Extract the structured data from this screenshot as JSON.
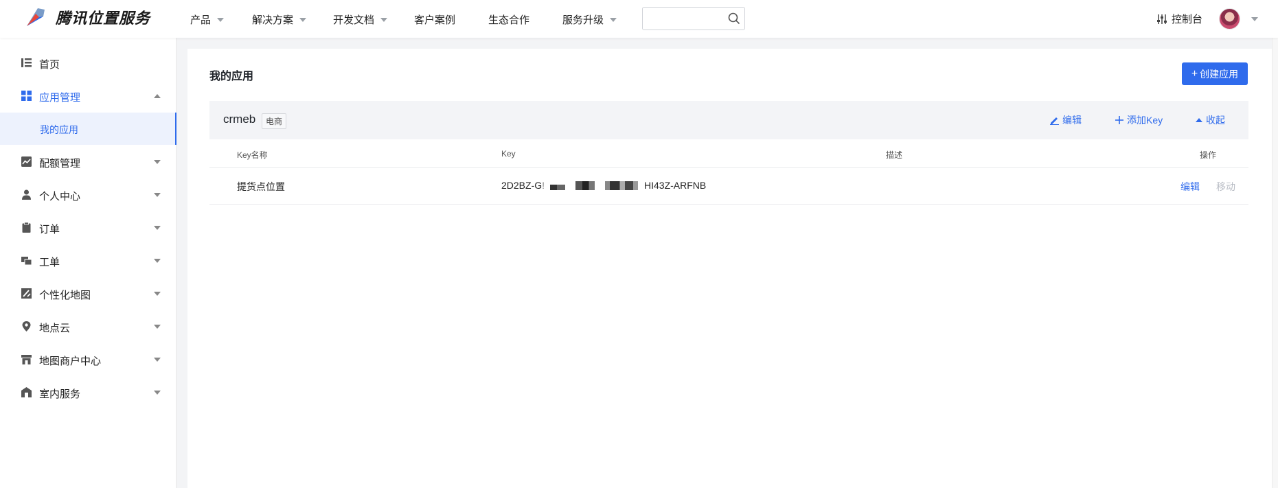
{
  "brand": {
    "name": "腾讯位置服务"
  },
  "nav": {
    "items": [
      {
        "label": "产品",
        "dropdown": true
      },
      {
        "label": "解决方案",
        "dropdown": true
      },
      {
        "label": "开发文档",
        "dropdown": true
      },
      {
        "label": "客户案例",
        "dropdown": false
      },
      {
        "label": "生态合作",
        "dropdown": false
      },
      {
        "label": "服务升级",
        "dropdown": true
      }
    ],
    "search_placeholder": "",
    "console_label": "控制台"
  },
  "sidebar": {
    "items": [
      {
        "label": "首页",
        "icon": "list-icon"
      },
      {
        "label": "应用管理",
        "icon": "grid-icon",
        "expanded": true
      },
      {
        "label": "我的应用",
        "sub": true,
        "selected": true
      },
      {
        "label": "配额管理",
        "icon": "chart-icon"
      },
      {
        "label": "个人中心",
        "icon": "user-icon"
      },
      {
        "label": "订单",
        "icon": "clipboard-icon"
      },
      {
        "label": "工单",
        "icon": "ticket-icon"
      },
      {
        "label": "个性化地图",
        "icon": "map-style-icon"
      },
      {
        "label": "地点云",
        "icon": "location-pin-icon"
      },
      {
        "label": "地图商户中心",
        "icon": "store-icon"
      },
      {
        "label": "室内服务",
        "icon": "building-icon"
      }
    ]
  },
  "main": {
    "title": "我的应用",
    "create_button": "创建应用",
    "app": {
      "name": "crmeb",
      "tag": "电商",
      "actions": {
        "edit": "编辑",
        "add_key": "添加Key",
        "collapse": "收起"
      },
      "table": {
        "headers": {
          "key_name": "Key名称",
          "key": "Key",
          "description": "描述",
          "operation": "操作"
        },
        "rows": [
          {
            "key_name": "提货点位置",
            "key_prefix": "2D2BZ-G",
            "key_suffix": "HI43Z-ARFNB",
            "description": "",
            "edit": "编辑",
            "move": "移动"
          }
        ]
      }
    }
  },
  "colors": {
    "accent": "#2f6bec",
    "disabled": "#b8bcc4"
  }
}
